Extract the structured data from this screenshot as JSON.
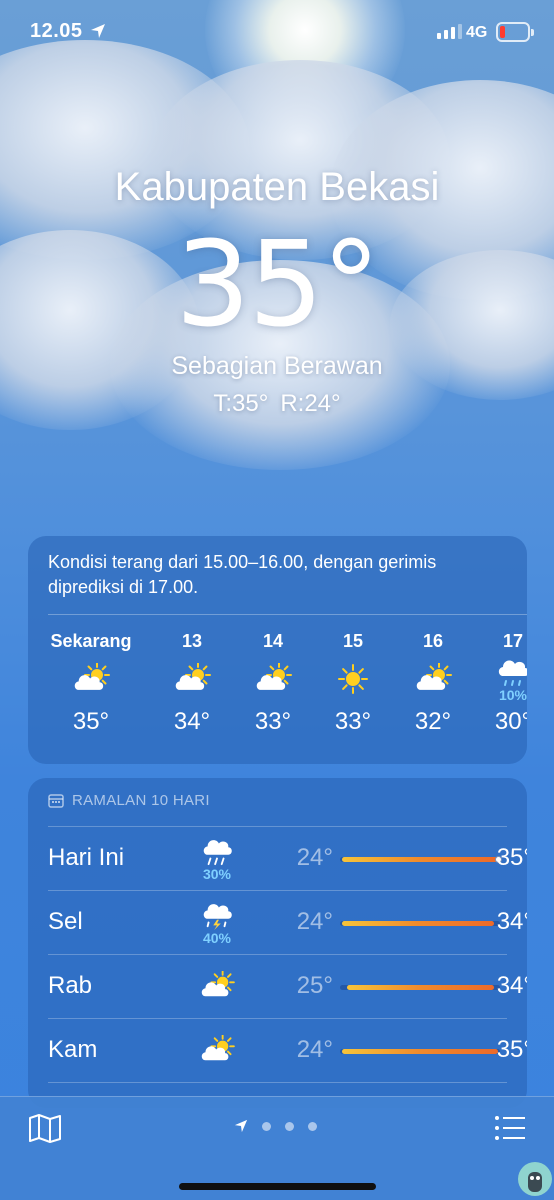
{
  "status_bar": {
    "time": "12.05",
    "network": "4G",
    "battery_level_fraction": 0.1
  },
  "header": {
    "city": "Kabupaten Bekasi",
    "temperature": "35°",
    "condition": "Sebagian Berawan",
    "high": "T:35°",
    "low": "R:24°"
  },
  "hourly": {
    "summary": "Kondisi terang dari 15.00–16.00, dengan gerimis diprediksi di 17.00.",
    "items": [
      {
        "label": "Sekarang",
        "icon": "partly-sunny-icon",
        "temp": "35°",
        "precip": ""
      },
      {
        "label": "13",
        "icon": "partly-sunny-icon",
        "temp": "34°",
        "precip": ""
      },
      {
        "label": "14",
        "icon": "partly-sunny-icon",
        "temp": "33°",
        "precip": ""
      },
      {
        "label": "15",
        "icon": "sun-icon",
        "temp": "33°",
        "precip": ""
      },
      {
        "label": "16",
        "icon": "partly-sunny-icon",
        "temp": "32°",
        "precip": ""
      },
      {
        "label": "17",
        "icon": "drizzle-icon",
        "temp": "30°",
        "precip": "10%"
      }
    ]
  },
  "daily": {
    "title": "RAMALAN 10 HARI",
    "range_min": 24,
    "range_max": 35,
    "items": [
      {
        "day": "Hari Ini",
        "icon": "rain-cloud-icon",
        "precip": "30%",
        "low": "24°",
        "high": "35°",
        "low_val": 24,
        "high_val": 35,
        "current_val": 35
      },
      {
        "day": "Sel",
        "icon": "thunderstorm-icon",
        "precip": "40%",
        "low": "24°",
        "high": "34°",
        "low_val": 24,
        "high_val": 34
      },
      {
        "day": "Rab",
        "icon": "partly-sunny-icon",
        "precip": "",
        "low": "25°",
        "high": "34°",
        "low_val": 25,
        "high_val": 34
      },
      {
        "day": "Kam",
        "icon": "partly-sunny-icon",
        "precip": "",
        "low": "24°",
        "high": "35°",
        "low_val": 24,
        "high_val": 35
      }
    ]
  },
  "bottom_bar": {
    "map_icon": "map-icon",
    "list_icon": "list-icon",
    "pages": 3
  }
}
